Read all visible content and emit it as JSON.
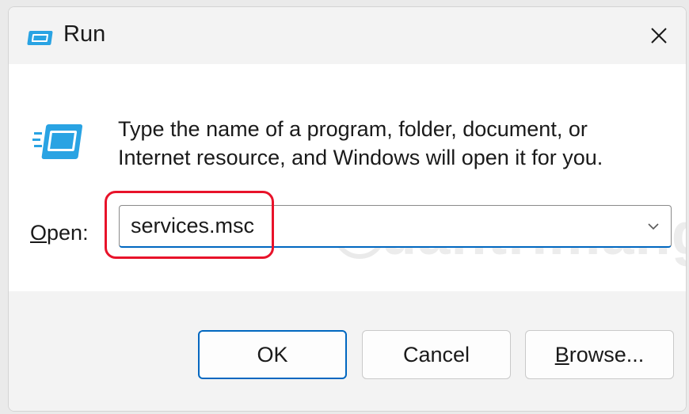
{
  "window": {
    "title": "Run",
    "close_glyph": "×",
    "title_icon": "run-icon"
  },
  "content": {
    "description_line1": "Type the name of a program, folder, document, or",
    "description_line2": "Internet resource, and Windows will open it for you.",
    "icon": "run-icon"
  },
  "open_field": {
    "label_mnemonic": "O",
    "label_rest": "pen:",
    "value": "services.msc"
  },
  "buttons": {
    "ok": "OK",
    "cancel": "Cancel",
    "browse_mnemonic": "B",
    "browse_rest": "rowse..."
  },
  "watermark": "uantrimang",
  "colors": {
    "accent": "#0067c0",
    "highlight": "#e8132a",
    "icon_blue": "#29a3e3"
  }
}
